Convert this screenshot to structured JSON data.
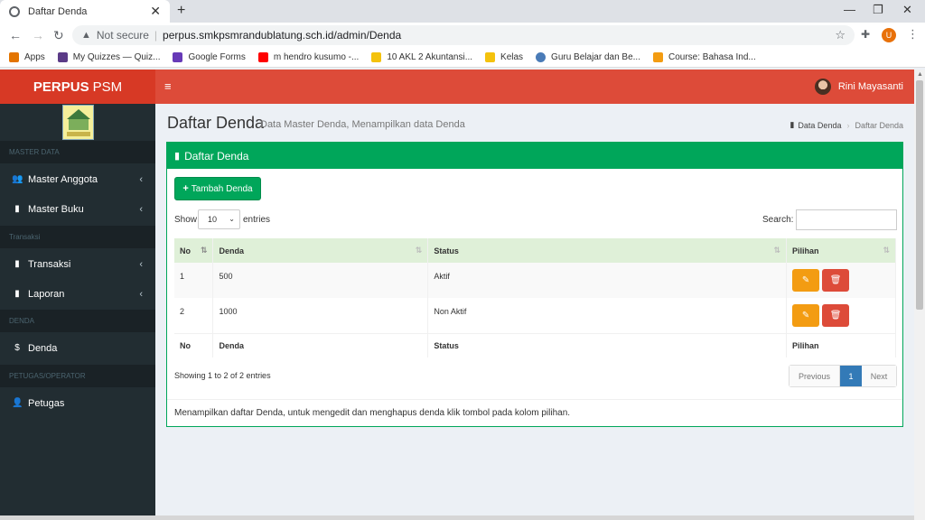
{
  "browser": {
    "tab_title": "Daftar Denda",
    "not_secure": "Not secure",
    "url": "perpus.smkpsmrandublatung.sch.id/admin/Denda",
    "profile_initial": "U",
    "bookmarks": [
      {
        "label": "Apps",
        "color": "#e37400"
      },
      {
        "label": "My Quizzes — Quiz...",
        "color": "#5b3b87"
      },
      {
        "label": "Google Forms",
        "color": "#673ab7"
      },
      {
        "label": "m hendro kusumo -...",
        "color": "#ff0000"
      },
      {
        "label": "10 AKL 2 Akuntansi...",
        "color": "#f4c20d"
      },
      {
        "label": "Kelas",
        "color": "#f4c20d"
      },
      {
        "label": "Guru Belajar dan Be...",
        "color": "#4a7bb7"
      },
      {
        "label": "Course: Bahasa Ind...",
        "color": "#f39c12"
      }
    ]
  },
  "header": {
    "logo_bold": "PERPUS",
    "logo_rest": "PSM",
    "user_name": "Rini Mayasanti"
  },
  "sidebar": {
    "sections": [
      "MASTER DATA",
      "Transaksi",
      "DENDA",
      "PETUGAS/OPERATOR"
    ],
    "items": [
      {
        "label": "Master Anggota",
        "icon": "users-icon"
      },
      {
        "label": "Master Buku",
        "icon": "book-icon"
      },
      {
        "label": "Transaksi",
        "icon": "book-icon"
      },
      {
        "label": "Laporan",
        "icon": "book-icon"
      },
      {
        "label": "Denda",
        "icon": "dollar-icon"
      },
      {
        "label": "Petugas",
        "icon": "user-plus-icon"
      }
    ]
  },
  "page": {
    "title": "Daftar Denda",
    "subtitle": "Data Master Denda, Menampilkan data Denda",
    "breadcrumb": [
      "Data Denda",
      "Daftar Denda"
    ]
  },
  "box": {
    "title": "Daftar Denda",
    "add_button": "Tambah Denda",
    "show_label": "Show",
    "entries_value": "10",
    "entries_label": "entries",
    "search_label": "Search:",
    "columns": [
      "No",
      "Denda",
      "Status",
      "Pilihan"
    ],
    "rows": [
      {
        "no": "1",
        "denda": "500",
        "status": "Aktif"
      },
      {
        "no": "2",
        "denda": "1000",
        "status": "Non Aktif"
      }
    ],
    "info": "Showing 1 to 2 of 2 entries",
    "pager": {
      "previous": "Previous",
      "current": "1",
      "next": "Next"
    },
    "footer": "Menampilkan daftar Denda, untuk mengedit dan menghapus denda klik tombol pada kolom pilihan."
  },
  "colors": {
    "brand": "#dd4b39",
    "brand_dark": "#d73925",
    "sidebar": "#222d32",
    "success": "#00a65a",
    "warning": "#f39c12",
    "primary": "#337ab7"
  }
}
